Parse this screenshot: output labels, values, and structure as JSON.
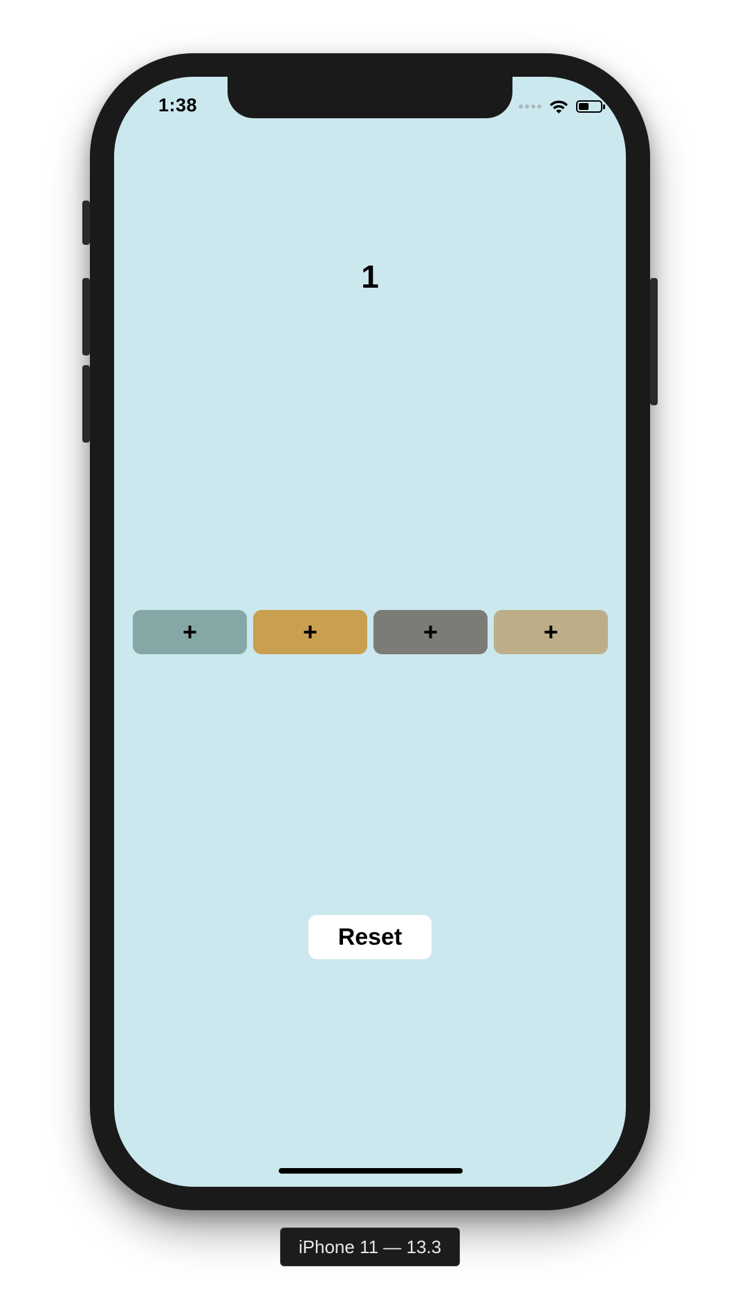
{
  "status_bar": {
    "time": "1:38",
    "icons": [
      "signal-dots-icon",
      "wifi-icon",
      "battery-icon"
    ],
    "battery_level": 0.4
  },
  "app": {
    "background_color": "#cbe8ee",
    "counter_value": "1",
    "plus_buttons": [
      {
        "label": "+",
        "color": "#85a8a6"
      },
      {
        "label": "+",
        "color": "#c9a050"
      },
      {
        "label": "+",
        "color": "#7c7c76"
      },
      {
        "label": "+",
        "color": "#bcae89"
      }
    ],
    "reset_label": "Reset"
  },
  "simulator": {
    "device_label": "iPhone 11 — 13.3"
  }
}
